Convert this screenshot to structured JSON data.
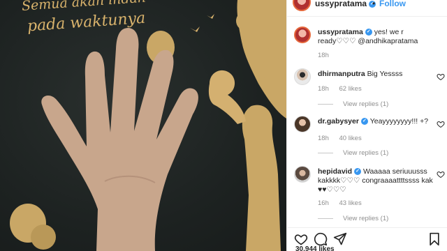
{
  "photo": {
    "text_line1": "Semua akan indah",
    "text_line2": "pada waktunya"
  },
  "header": {
    "username": "ussypratama",
    "verified": "✓",
    "dot": "•",
    "follow": "Follow"
  },
  "caption": {
    "username": "ussypratama",
    "text": "yes! we r ready♡♡♡ @andhikapratama",
    "time": "18h"
  },
  "comments": [
    {
      "username": "dhirmanputra",
      "text": "Big Yessss",
      "time": "18h",
      "likes": "62 likes",
      "replies": "View replies (1)"
    },
    {
      "username": "dr.gabysyer",
      "text": "Yeayyyyyyyy!!! +?",
      "time": "18h",
      "likes": "40 likes",
      "replies": "View replies (1)"
    },
    {
      "username": "hepidavid",
      "text": "Waaaaa seriuuusss kakkkk♡♡♡ congraaaattttssss kak ♥♥♡♡♡",
      "time": "16h",
      "likes": "43 likes",
      "replies": "View replies (1)"
    }
  ],
  "likes_total": "30,944 likes",
  "colors": {
    "accent": "#3897f0",
    "gold": "#d9b36c",
    "photo_bg": "#1d2221"
  }
}
